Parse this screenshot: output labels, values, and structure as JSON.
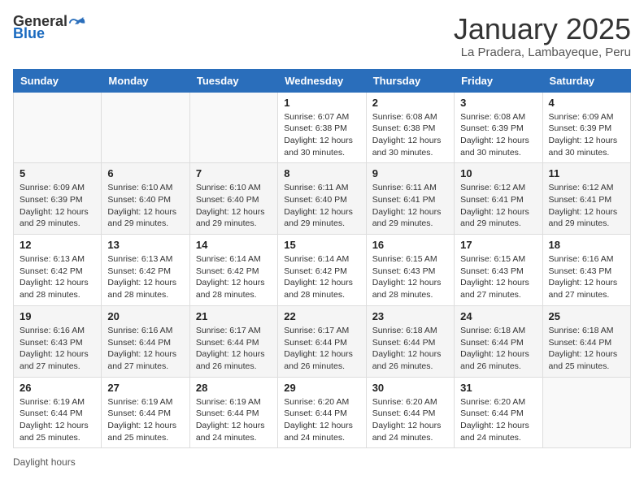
{
  "header": {
    "logo_general": "General",
    "logo_blue": "Blue",
    "month_title": "January 2025",
    "location": "La Pradera, Lambayeque, Peru"
  },
  "calendar": {
    "weekdays": [
      "Sunday",
      "Monday",
      "Tuesday",
      "Wednesday",
      "Thursday",
      "Friday",
      "Saturday"
    ],
    "weeks": [
      [
        {
          "day": "",
          "info": ""
        },
        {
          "day": "",
          "info": ""
        },
        {
          "day": "",
          "info": ""
        },
        {
          "day": "1",
          "info": "Sunrise: 6:07 AM\nSunset: 6:38 PM\nDaylight: 12 hours and 30 minutes."
        },
        {
          "day": "2",
          "info": "Sunrise: 6:08 AM\nSunset: 6:38 PM\nDaylight: 12 hours and 30 minutes."
        },
        {
          "day": "3",
          "info": "Sunrise: 6:08 AM\nSunset: 6:39 PM\nDaylight: 12 hours and 30 minutes."
        },
        {
          "day": "4",
          "info": "Sunrise: 6:09 AM\nSunset: 6:39 PM\nDaylight: 12 hours and 30 minutes."
        }
      ],
      [
        {
          "day": "5",
          "info": "Sunrise: 6:09 AM\nSunset: 6:39 PM\nDaylight: 12 hours and 29 minutes."
        },
        {
          "day": "6",
          "info": "Sunrise: 6:10 AM\nSunset: 6:40 PM\nDaylight: 12 hours and 29 minutes."
        },
        {
          "day": "7",
          "info": "Sunrise: 6:10 AM\nSunset: 6:40 PM\nDaylight: 12 hours and 29 minutes."
        },
        {
          "day": "8",
          "info": "Sunrise: 6:11 AM\nSunset: 6:40 PM\nDaylight: 12 hours and 29 minutes."
        },
        {
          "day": "9",
          "info": "Sunrise: 6:11 AM\nSunset: 6:41 PM\nDaylight: 12 hours and 29 minutes."
        },
        {
          "day": "10",
          "info": "Sunrise: 6:12 AM\nSunset: 6:41 PM\nDaylight: 12 hours and 29 minutes."
        },
        {
          "day": "11",
          "info": "Sunrise: 6:12 AM\nSunset: 6:41 PM\nDaylight: 12 hours and 29 minutes."
        }
      ],
      [
        {
          "day": "12",
          "info": "Sunrise: 6:13 AM\nSunset: 6:42 PM\nDaylight: 12 hours and 28 minutes."
        },
        {
          "day": "13",
          "info": "Sunrise: 6:13 AM\nSunset: 6:42 PM\nDaylight: 12 hours and 28 minutes."
        },
        {
          "day": "14",
          "info": "Sunrise: 6:14 AM\nSunset: 6:42 PM\nDaylight: 12 hours and 28 minutes."
        },
        {
          "day": "15",
          "info": "Sunrise: 6:14 AM\nSunset: 6:42 PM\nDaylight: 12 hours and 28 minutes."
        },
        {
          "day": "16",
          "info": "Sunrise: 6:15 AM\nSunset: 6:43 PM\nDaylight: 12 hours and 28 minutes."
        },
        {
          "day": "17",
          "info": "Sunrise: 6:15 AM\nSunset: 6:43 PM\nDaylight: 12 hours and 27 minutes."
        },
        {
          "day": "18",
          "info": "Sunrise: 6:16 AM\nSunset: 6:43 PM\nDaylight: 12 hours and 27 minutes."
        }
      ],
      [
        {
          "day": "19",
          "info": "Sunrise: 6:16 AM\nSunset: 6:43 PM\nDaylight: 12 hours and 27 minutes."
        },
        {
          "day": "20",
          "info": "Sunrise: 6:16 AM\nSunset: 6:44 PM\nDaylight: 12 hours and 27 minutes."
        },
        {
          "day": "21",
          "info": "Sunrise: 6:17 AM\nSunset: 6:44 PM\nDaylight: 12 hours and 26 minutes."
        },
        {
          "day": "22",
          "info": "Sunrise: 6:17 AM\nSunset: 6:44 PM\nDaylight: 12 hours and 26 minutes."
        },
        {
          "day": "23",
          "info": "Sunrise: 6:18 AM\nSunset: 6:44 PM\nDaylight: 12 hours and 26 minutes."
        },
        {
          "day": "24",
          "info": "Sunrise: 6:18 AM\nSunset: 6:44 PM\nDaylight: 12 hours and 26 minutes."
        },
        {
          "day": "25",
          "info": "Sunrise: 6:18 AM\nSunset: 6:44 PM\nDaylight: 12 hours and 25 minutes."
        }
      ],
      [
        {
          "day": "26",
          "info": "Sunrise: 6:19 AM\nSunset: 6:44 PM\nDaylight: 12 hours and 25 minutes."
        },
        {
          "day": "27",
          "info": "Sunrise: 6:19 AM\nSunset: 6:44 PM\nDaylight: 12 hours and 25 minutes."
        },
        {
          "day": "28",
          "info": "Sunrise: 6:19 AM\nSunset: 6:44 PM\nDaylight: 12 hours and 24 minutes."
        },
        {
          "day": "29",
          "info": "Sunrise: 6:20 AM\nSunset: 6:44 PM\nDaylight: 12 hours and 24 minutes."
        },
        {
          "day": "30",
          "info": "Sunrise: 6:20 AM\nSunset: 6:44 PM\nDaylight: 12 hours and 24 minutes."
        },
        {
          "day": "31",
          "info": "Sunrise: 6:20 AM\nSunset: 6:44 PM\nDaylight: 12 hours and 24 minutes."
        },
        {
          "day": "",
          "info": ""
        }
      ]
    ]
  },
  "footer": {
    "daylight_label": "Daylight hours"
  }
}
